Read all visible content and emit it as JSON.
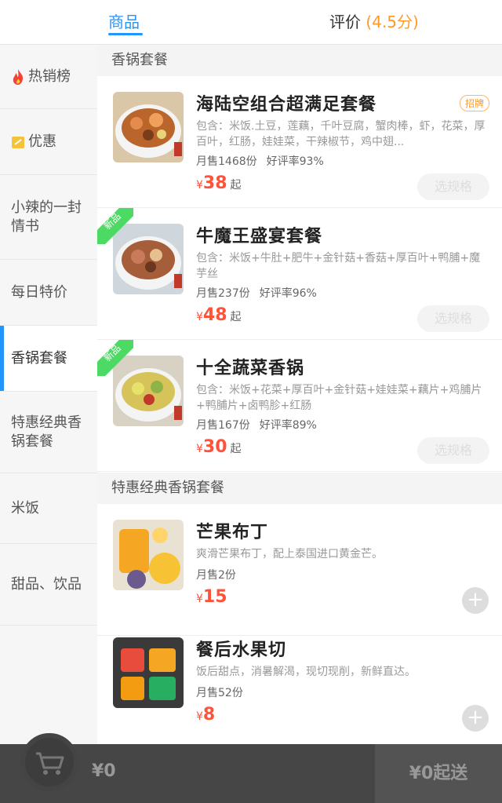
{
  "tabs": {
    "goods": "商品",
    "review_label": "评价",
    "review_score": "(4.5分)"
  },
  "sidebar": {
    "items": [
      {
        "label": "热销榜"
      },
      {
        "label": "优惠"
      },
      {
        "label": "小辣的一封情书"
      },
      {
        "label": "每日特价"
      },
      {
        "label": "香锅套餐"
      },
      {
        "label": "特惠经典香锅套餐"
      },
      {
        "label": "米饭"
      },
      {
        "label": "甜品、饮品"
      }
    ]
  },
  "sections": [
    {
      "title": "香锅套餐"
    },
    {
      "title": "特惠经典香锅套餐"
    }
  ],
  "products": [
    {
      "name": "海陆空组合超满足套餐",
      "badge": "招牌",
      "desc": "包含：米饭.土豆，莲藕，千叶豆腐，蟹肉棒，虾，花菜，厚百叶，红肠，娃娃菜，干辣椒节，鸡中翅...",
      "sales": "月售1468份",
      "rating": "好评率93%",
      "yen": "¥",
      "price": "38",
      "suffix": "起",
      "action": "选规格"
    },
    {
      "name": "牛魔王盛宴套餐",
      "ribbon": "新品",
      "desc": "包含：米饭+牛肚+肥牛+金针菇+香菇+厚百叶+鸭脯+魔芋丝",
      "sales": "月售237份",
      "rating": "好评率96%",
      "yen": "¥",
      "price": "48",
      "suffix": "起",
      "action": "选规格"
    },
    {
      "name": "十全蔬菜香锅",
      "ribbon": "新品",
      "desc": "包含：米饭+花菜+厚百叶+金针菇+娃娃菜+藕片+鸡脯片+鸭脯片+卤鸭胗+红肠",
      "sales": "月售167份",
      "rating": "好评率89%",
      "yen": "¥",
      "price": "30",
      "suffix": "起",
      "action": "选规格"
    },
    {
      "name": "芒果布丁",
      "desc": "爽滑芒果布丁，配上泰国进口黄金芒。",
      "sales": "月售2份",
      "yen": "¥",
      "price": "15"
    },
    {
      "name": "餐后水果切",
      "desc": "饭后甜点，消暑解渴，现切现削，新鲜直达。",
      "sales": "月售52份",
      "yen": "¥",
      "price": "8"
    }
  ],
  "cart": {
    "total": "¥0",
    "checkout": "¥0起送"
  },
  "colors": {
    "accent": "#2395ff",
    "price": "#ff5339",
    "new_badge": "#4cd964",
    "score": "#ff9a28"
  }
}
